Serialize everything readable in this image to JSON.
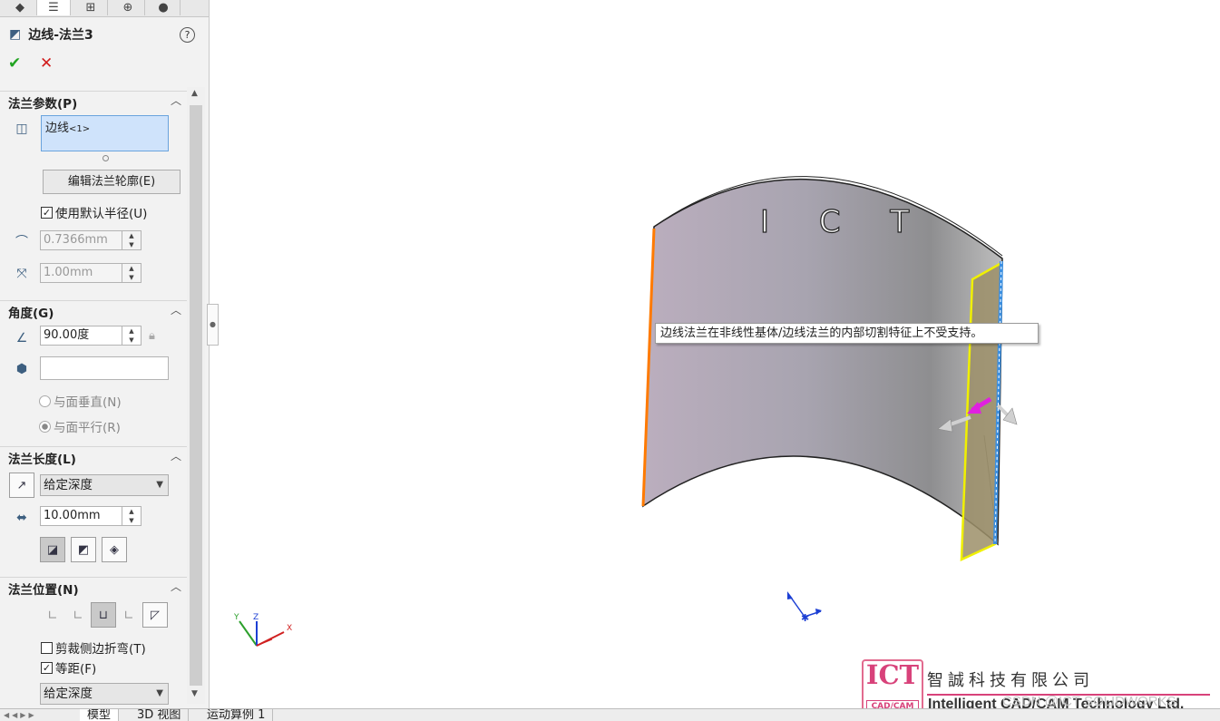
{
  "panel": {
    "feature_title": "边线-法兰3",
    "help_label": "?",
    "ok_label": "✔",
    "cancel_label": "✕",
    "tabs": [
      "feature-manager-tab",
      "property-manager-tab",
      "configuration-manager-tab",
      "dimxpert-tab",
      "display-manager-tab"
    ],
    "flange_params": {
      "header": "法兰参数(P)",
      "selection_value": "边线",
      "selection_suffix": "<1>",
      "edit_profile_button": "编辑法兰轮廓(E)",
      "use_default_radius_label": "使用默认半径(U)",
      "use_default_radius_checked": true,
      "radius_value": "0.7366mm",
      "gap_value": "1.00mm"
    },
    "angle": {
      "header": "角度(G)",
      "angle_value": "90.00度",
      "reference_value": "",
      "perpendicular_label": "与面垂直(N)",
      "parallel_label": "与面平行(R)",
      "parallel_selected": true
    },
    "flange_length": {
      "header": "法兰长度(L)",
      "end_condition": "给定深度",
      "length_value": "10.00mm"
    },
    "flange_position": {
      "header": "法兰位置(N)",
      "trim_side_bends_label": "剪裁侧边折弯(T)",
      "trim_side_bends_checked": false,
      "offset_label": "等距(F)",
      "offset_checked": true,
      "offset_condition": "给定深度"
    }
  },
  "bottom_tabs": [
    "模型",
    "3D 视图",
    "运动算例 1"
  ],
  "viewport": {
    "tooltip": "边线法兰在非线性基体/边线法兰的内部切割特征上不受支持。",
    "engraved_text": "I C T",
    "triad_labels": {
      "x": "X",
      "y": "Y",
      "z": "Z"
    }
  },
  "logo": {
    "ict": "ICT",
    "cadcam": "CAD/CAM",
    "chinese_name": "智誠科技有限公司",
    "english_name": "Intelligent CAD/CAM Technology Ltd."
  },
  "watermark": "CSDN @ICT SOLIDWORKS",
  "colors": {
    "accent_pink": "#d8427a",
    "selection_blue": "#cfe3fb",
    "ok_green": "#22a422",
    "cancel_red": "#d11c1c"
  }
}
